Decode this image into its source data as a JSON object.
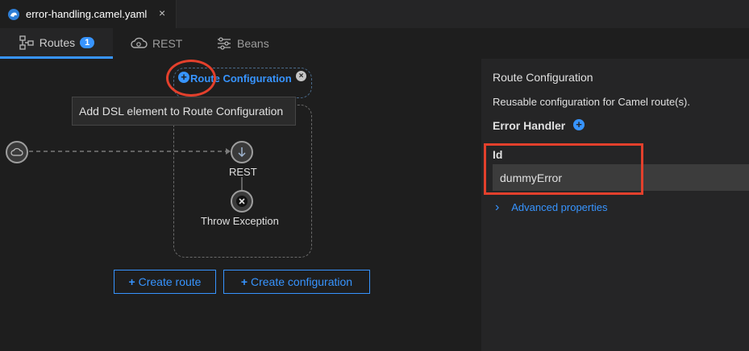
{
  "editor_tab": {
    "filename": "error-handling.camel.yaml",
    "close_glyph": "×",
    "icon": "camel-file-icon"
  },
  "designer_tabs": [
    {
      "label": "Routes",
      "badge": "1",
      "icon": "routes-icon",
      "active": true
    },
    {
      "label": "REST",
      "icon": "rest-cloud-icon",
      "active": false
    },
    {
      "label": "Beans",
      "icon": "beans-sliders-icon",
      "active": false
    }
  ],
  "canvas": {
    "route_configuration_label": "Route Configuration",
    "tooltip": "Add DSL element to Route Configuration",
    "nodes": [
      {
        "label": "REST",
        "icon": "arrow-down-icon"
      },
      {
        "label": "Throw Exception",
        "icon": "x-circle-icon"
      }
    ],
    "buttons": {
      "create_route": "Create route",
      "create_configuration": "Create configuration",
      "plus_glyph": "+"
    }
  },
  "properties_panel": {
    "title": "Route Configuration",
    "description": "Reusable configuration for Camel route(s).",
    "error_handler_label": "Error Handler",
    "id_label": "Id",
    "id_value": "dummyError",
    "advanced_label": "Advanced properties",
    "advanced_chevron": "›"
  },
  "colors": {
    "accent": "#3794ff",
    "highlight": "#e3402c",
    "background": "#1e1e1e",
    "panel": "#252526"
  }
}
